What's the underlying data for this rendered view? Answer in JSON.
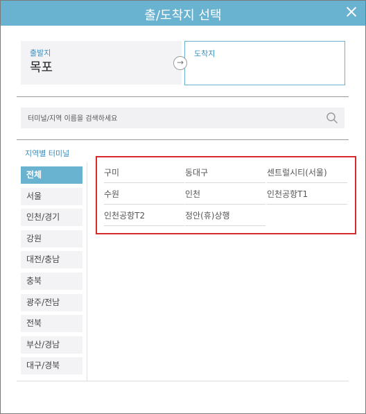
{
  "dialog": {
    "title": "출/도착지 선택"
  },
  "departure": {
    "label": "출발지",
    "value": "목포"
  },
  "arrival": {
    "label": "도착지",
    "value": ""
  },
  "swap_symbol": "→",
  "search": {
    "placeholder": "터미널/지역 이름을 검색하세요",
    "value": ""
  },
  "region_title": "지역별 터미널",
  "regions": [
    "전체",
    "서울",
    "인천/경기",
    "강원",
    "대전/충남",
    "충북",
    "광주/전남",
    "전북",
    "부산/경남",
    "대구/경북"
  ],
  "selected_region": "전체",
  "terminals": [
    "구미",
    "동대구",
    "센트럴시티(서울)",
    "수원",
    "인천",
    "인천공항T1",
    "인천공항T2",
    "정안(휴)상행"
  ],
  "colors": {
    "accent": "#6ab3d0",
    "label_blue": "#3a8fc0",
    "highlight_border": "#d62a2a",
    "panel_bg": "#f3f3f5"
  },
  "icons": {
    "close": "close-icon",
    "search": "search-icon",
    "swap": "swap-arrow-icon"
  }
}
